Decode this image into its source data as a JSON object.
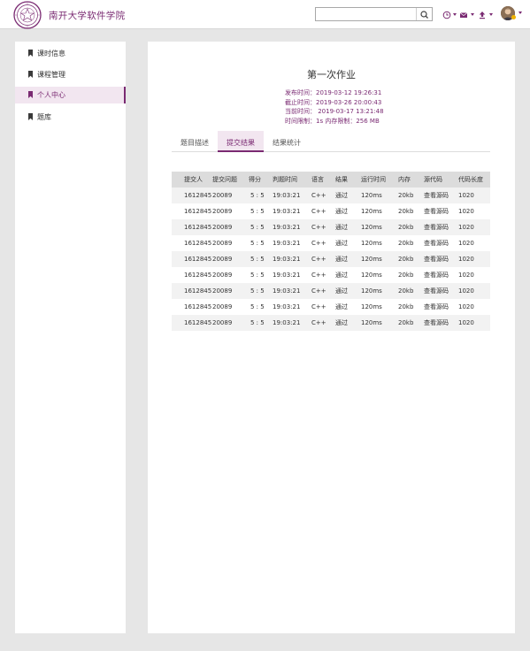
{
  "header": {
    "brand": "南开大学软件学院",
    "search": {
      "placeholder": "",
      "value": ""
    },
    "icons": [
      "clock-icon",
      "mail-icon",
      "upload-icon"
    ],
    "accent_color": "#7a2a72"
  },
  "sidebar": {
    "items": [
      {
        "label": "课时信息",
        "active": false
      },
      {
        "label": "课程管理",
        "active": false
      },
      {
        "label": "个人中心",
        "active": true
      },
      {
        "label": "题库",
        "active": false
      }
    ]
  },
  "assignment": {
    "title": "第一次作业",
    "publish_time": "发布时间：2019-03-12 19:26:31",
    "deadline": "截止时间：2019-03-26 20:00:43",
    "current_time": "当前时间： 2019-03-17 13:21:48",
    "limits": "时间限制：1s  内存限制：256 MB"
  },
  "tabs": [
    {
      "label": "题目描述",
      "active": false
    },
    {
      "label": "提交结果",
      "active": true
    },
    {
      "label": "结果统计",
      "active": false
    }
  ],
  "table": {
    "headers": [
      "提交人",
      "提交问题",
      "得分",
      "判题时间",
      "语言",
      "结果",
      "运行时间",
      "内存",
      "源代码",
      "代码长度"
    ],
    "rows": [
      [
        "1612845",
        "20089",
        "5 : 5",
        "19:03:21",
        "C++",
        "通过",
        "120ms",
        "20kb",
        "查看源码",
        "1020"
      ],
      [
        "1612845",
        "20089",
        "5 : 5",
        "19:03:21",
        "C++",
        "通过",
        "120ms",
        "20kb",
        "查看源码",
        "1020"
      ],
      [
        "1612845",
        "20089",
        "5 : 5",
        "19:03:21",
        "C++",
        "通过",
        "120ms",
        "20kb",
        "查看源码",
        "1020"
      ],
      [
        "1612845",
        "20089",
        "5 : 5",
        "19:03:21",
        "C++",
        "通过",
        "120ms",
        "20kb",
        "查看源码",
        "1020"
      ],
      [
        "1612845",
        "20089",
        "5 : 5",
        "19:03:21",
        "C++",
        "通过",
        "120ms",
        "20kb",
        "查看源码",
        "1020"
      ],
      [
        "1612845",
        "20089",
        "5 : 5",
        "19:03:21",
        "C++",
        "通过",
        "120ms",
        "20kb",
        "查看源码",
        "1020"
      ],
      [
        "1612845",
        "20089",
        "5 : 5",
        "19:03:21",
        "C++",
        "通过",
        "120ms",
        "20kb",
        "查看源码",
        "1020"
      ],
      [
        "1612845",
        "20089",
        "5 : 5",
        "19:03:21",
        "C++",
        "通过",
        "120ms",
        "20kb",
        "查看源码",
        "1020"
      ],
      [
        "1612845",
        "20089",
        "5 : 5",
        "19:03:21",
        "C++",
        "通过",
        "120ms",
        "20kb",
        "查看源码",
        "1020"
      ]
    ]
  }
}
